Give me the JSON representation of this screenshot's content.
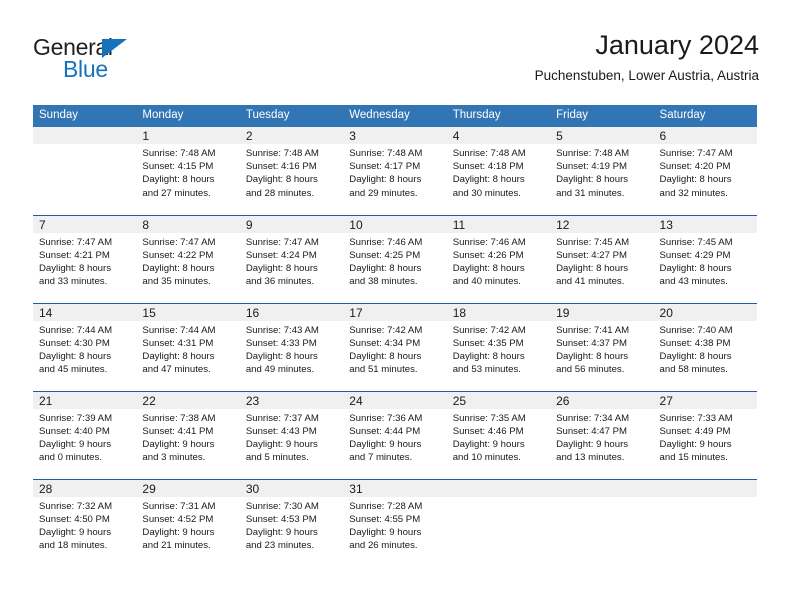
{
  "brand": {
    "name_top": "General",
    "name_bottom": "Blue",
    "triangle_icon": "triangle-icon",
    "accent_color": "#1573be"
  },
  "header": {
    "title": "January 2024",
    "subtitle": "Puchenstuben, Lower Austria, Austria"
  },
  "calendar": {
    "header_color": "#3175b4",
    "daynum_bg": "#f0f0f0",
    "weekday_headers": [
      "Sunday",
      "Monday",
      "Tuesday",
      "Wednesday",
      "Thursday",
      "Friday",
      "Saturday"
    ],
    "weeks": [
      [
        {
          "day": "",
          "lines": []
        },
        {
          "day": "1",
          "lines": [
            "Sunrise: 7:48 AM",
            "Sunset: 4:15 PM",
            "Daylight: 8 hours",
            "and 27 minutes."
          ]
        },
        {
          "day": "2",
          "lines": [
            "Sunrise: 7:48 AM",
            "Sunset: 4:16 PM",
            "Daylight: 8 hours",
            "and 28 minutes."
          ]
        },
        {
          "day": "3",
          "lines": [
            "Sunrise: 7:48 AM",
            "Sunset: 4:17 PM",
            "Daylight: 8 hours",
            "and 29 minutes."
          ]
        },
        {
          "day": "4",
          "lines": [
            "Sunrise: 7:48 AM",
            "Sunset: 4:18 PM",
            "Daylight: 8 hours",
            "and 30 minutes."
          ]
        },
        {
          "day": "5",
          "lines": [
            "Sunrise: 7:48 AM",
            "Sunset: 4:19 PM",
            "Daylight: 8 hours",
            "and 31 minutes."
          ]
        },
        {
          "day": "6",
          "lines": [
            "Sunrise: 7:47 AM",
            "Sunset: 4:20 PM",
            "Daylight: 8 hours",
            "and 32 minutes."
          ]
        }
      ],
      [
        {
          "day": "7",
          "lines": [
            "Sunrise: 7:47 AM",
            "Sunset: 4:21 PM",
            "Daylight: 8 hours",
            "and 33 minutes."
          ]
        },
        {
          "day": "8",
          "lines": [
            "Sunrise: 7:47 AM",
            "Sunset: 4:22 PM",
            "Daylight: 8 hours",
            "and 35 minutes."
          ]
        },
        {
          "day": "9",
          "lines": [
            "Sunrise: 7:47 AM",
            "Sunset: 4:24 PM",
            "Daylight: 8 hours",
            "and 36 minutes."
          ]
        },
        {
          "day": "10",
          "lines": [
            "Sunrise: 7:46 AM",
            "Sunset: 4:25 PM",
            "Daylight: 8 hours",
            "and 38 minutes."
          ]
        },
        {
          "day": "11",
          "lines": [
            "Sunrise: 7:46 AM",
            "Sunset: 4:26 PM",
            "Daylight: 8 hours",
            "and 40 minutes."
          ]
        },
        {
          "day": "12",
          "lines": [
            "Sunrise: 7:45 AM",
            "Sunset: 4:27 PM",
            "Daylight: 8 hours",
            "and 41 minutes."
          ]
        },
        {
          "day": "13",
          "lines": [
            "Sunrise: 7:45 AM",
            "Sunset: 4:29 PM",
            "Daylight: 8 hours",
            "and 43 minutes."
          ]
        }
      ],
      [
        {
          "day": "14",
          "lines": [
            "Sunrise: 7:44 AM",
            "Sunset: 4:30 PM",
            "Daylight: 8 hours",
            "and 45 minutes."
          ]
        },
        {
          "day": "15",
          "lines": [
            "Sunrise: 7:44 AM",
            "Sunset: 4:31 PM",
            "Daylight: 8 hours",
            "and 47 minutes."
          ]
        },
        {
          "day": "16",
          "lines": [
            "Sunrise: 7:43 AM",
            "Sunset: 4:33 PM",
            "Daylight: 8 hours",
            "and 49 minutes."
          ]
        },
        {
          "day": "17",
          "lines": [
            "Sunrise: 7:42 AM",
            "Sunset: 4:34 PM",
            "Daylight: 8 hours",
            "and 51 minutes."
          ]
        },
        {
          "day": "18",
          "lines": [
            "Sunrise: 7:42 AM",
            "Sunset: 4:35 PM",
            "Daylight: 8 hours",
            "and 53 minutes."
          ]
        },
        {
          "day": "19",
          "lines": [
            "Sunrise: 7:41 AM",
            "Sunset: 4:37 PM",
            "Daylight: 8 hours",
            "and 56 minutes."
          ]
        },
        {
          "day": "20",
          "lines": [
            "Sunrise: 7:40 AM",
            "Sunset: 4:38 PM",
            "Daylight: 8 hours",
            "and 58 minutes."
          ]
        }
      ],
      [
        {
          "day": "21",
          "lines": [
            "Sunrise: 7:39 AM",
            "Sunset: 4:40 PM",
            "Daylight: 9 hours",
            "and 0 minutes."
          ]
        },
        {
          "day": "22",
          "lines": [
            "Sunrise: 7:38 AM",
            "Sunset: 4:41 PM",
            "Daylight: 9 hours",
            "and 3 minutes."
          ]
        },
        {
          "day": "23",
          "lines": [
            "Sunrise: 7:37 AM",
            "Sunset: 4:43 PM",
            "Daylight: 9 hours",
            "and 5 minutes."
          ]
        },
        {
          "day": "24",
          "lines": [
            "Sunrise: 7:36 AM",
            "Sunset: 4:44 PM",
            "Daylight: 9 hours",
            "and 7 minutes."
          ]
        },
        {
          "day": "25",
          "lines": [
            "Sunrise: 7:35 AM",
            "Sunset: 4:46 PM",
            "Daylight: 9 hours",
            "and 10 minutes."
          ]
        },
        {
          "day": "26",
          "lines": [
            "Sunrise: 7:34 AM",
            "Sunset: 4:47 PM",
            "Daylight: 9 hours",
            "and 13 minutes."
          ]
        },
        {
          "day": "27",
          "lines": [
            "Sunrise: 7:33 AM",
            "Sunset: 4:49 PM",
            "Daylight: 9 hours",
            "and 15 minutes."
          ]
        }
      ],
      [
        {
          "day": "28",
          "lines": [
            "Sunrise: 7:32 AM",
            "Sunset: 4:50 PM",
            "Daylight: 9 hours",
            "and 18 minutes."
          ]
        },
        {
          "day": "29",
          "lines": [
            "Sunrise: 7:31 AM",
            "Sunset: 4:52 PM",
            "Daylight: 9 hours",
            "and 21 minutes."
          ]
        },
        {
          "day": "30",
          "lines": [
            "Sunrise: 7:30 AM",
            "Sunset: 4:53 PM",
            "Daylight: 9 hours",
            "and 23 minutes."
          ]
        },
        {
          "day": "31",
          "lines": [
            "Sunrise: 7:28 AM",
            "Sunset: 4:55 PM",
            "Daylight: 9 hours",
            "and 26 minutes."
          ]
        },
        {
          "day": "",
          "lines": []
        },
        {
          "day": "",
          "lines": []
        },
        {
          "day": "",
          "lines": []
        }
      ]
    ]
  }
}
